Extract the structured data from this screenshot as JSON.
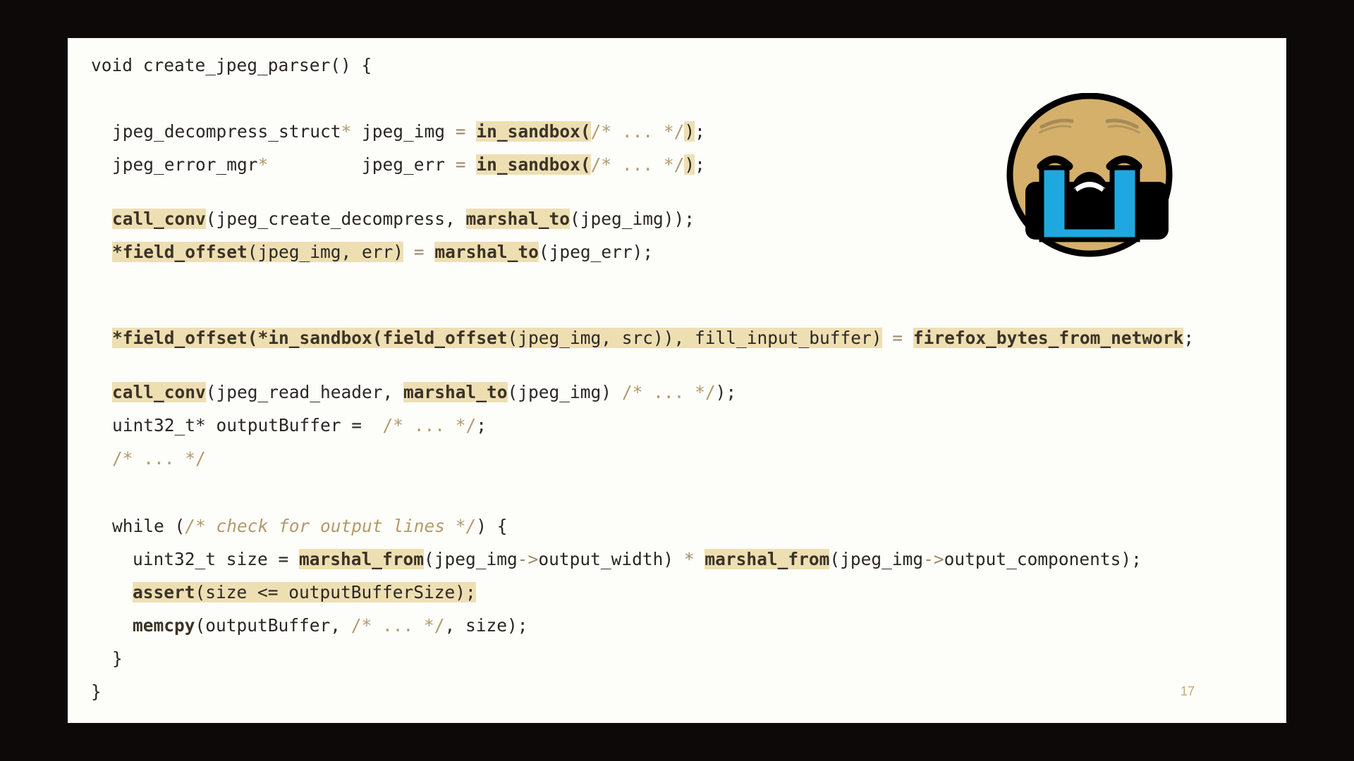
{
  "slide": {
    "page_number": "17",
    "emoji_icon": "loudly-crying-face-icon",
    "colors": {
      "highlight": "#eedfb3",
      "comment": "#b29a6a",
      "face": "#d4b06a",
      "tears": "#1fa8e0"
    }
  },
  "code": {
    "l01": {
      "t1": "void create_jpeg_parser() {"
    },
    "l02": {
      "t1": "jpeg_decompress_struct",
      "t2": "*",
      "t3": " jpeg_img ",
      "t4": "=",
      "t5": " ",
      "h1": "in_sandbox(",
      "t6": "/* ... */",
      "h2": ")",
      "t7": ";"
    },
    "l03": {
      "t1": "jpeg_error_mgr",
      "t2": "*",
      "t3": "         jpeg_err ",
      "t4": "=",
      "t5": " ",
      "h1": "in_sandbox(",
      "t6": "/* ... */",
      "h2": ")",
      "t7": ";"
    },
    "l04": {
      "h1": "call_conv",
      "t1": "(jpeg_create_decompress, ",
      "h2": "marshal_to",
      "t2": "(jpeg_img));"
    },
    "l05": {
      "h1a": "*field_offset",
      "h1b": "(jpeg_img, err)",
      "t1": " ",
      "t2": "=",
      "t3": " ",
      "h2": "marshal_to",
      "t4": "(jpeg_err);"
    },
    "l06": {
      "h1a": "*field_offset(*in_sandbox(field_offset",
      "h1b": "(jpeg_img, src)), fill_input_buffer)",
      "t1": " ",
      "t2": "=",
      "t3": " ",
      "h2": "firefox_bytes_from_network",
      "t4": ";"
    },
    "l07": {
      "h1": "call_conv",
      "t1": "(jpeg_read_header, ",
      "h2": "marshal_to",
      "t2": "(jpeg_img) ",
      "c1": "/* ... */",
      "t3": ");"
    },
    "l08": {
      "t1": "uint32_t* outputBuffer =  ",
      "c1": "/* ... */",
      "t2": ";"
    },
    "l09": {
      "c1": "/* ... */"
    },
    "l10": {
      "t1": "while (",
      "c1": "/* check for output lines */",
      "t2": ") {"
    },
    "l11": {
      "t1": "uint32_t size = ",
      "h1": "marshal_from",
      "t2": "(jpeg_img",
      "o1": "->",
      "t3": "output_width) ",
      "o2": "*",
      "t4": " ",
      "h2": "marshal_from",
      "t5": "(jpeg_img",
      "o3": "->",
      "t6": "output_components);"
    },
    "l12": {
      "h1a": "assert",
      "h1b": "(size <= outputBufferSize);"
    },
    "l13": {
      "t1": "memcpy",
      "t2": "(outputBuffer, ",
      "c1": "/* ... */",
      "t3": ", size);"
    },
    "l14": {
      "t1": "}"
    },
    "l15": {
      "t1": "}"
    }
  }
}
